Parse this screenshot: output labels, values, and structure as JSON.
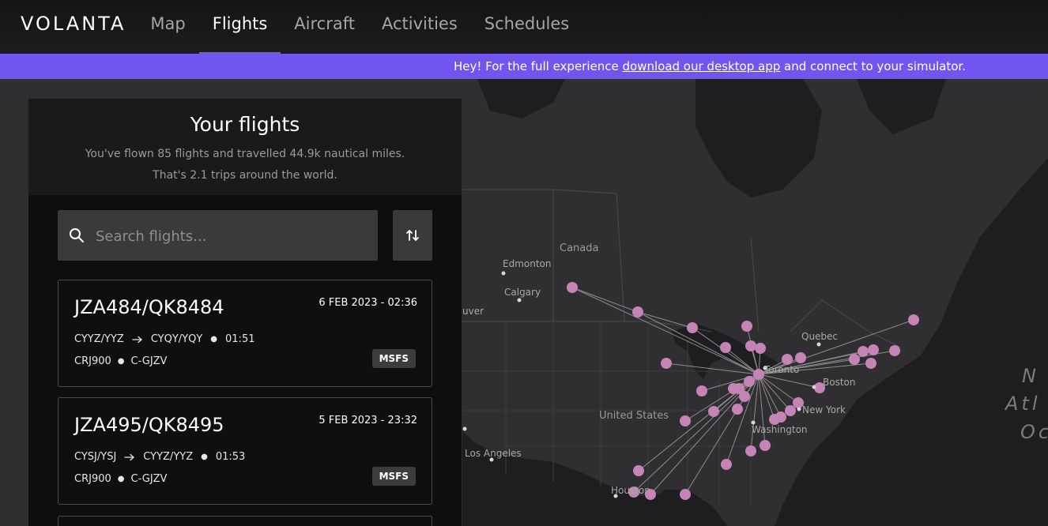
{
  "header": {
    "logo": "VOLANTA",
    "nav": [
      {
        "label": "Map"
      },
      {
        "label": "Flights"
      },
      {
        "label": "Aircraft"
      },
      {
        "label": "Activities"
      },
      {
        "label": "Schedules"
      }
    ],
    "active_nav": "Flights"
  },
  "banner": {
    "prefix": "Hey! For the full experience ",
    "link": "download our desktop app",
    "suffix": " and connect to your simulator."
  },
  "panel": {
    "title": "Your flights",
    "subtitle_line1": "You've flown 85 flights and travelled 44.9k nautical miles.",
    "subtitle_line2": "That's 2.1 trips around the world.",
    "search": {
      "placeholder": "Search flights..."
    },
    "flights": [
      {
        "callsign": "JZA484/QK8484",
        "date": "6 FEB 2023 - 02:36",
        "origin": "CYYZ/YYZ",
        "destination": "CYQY/YQY",
        "duration": "01:51",
        "aircraft_type": "CRJ900",
        "registration": "C-GJZV",
        "simulator": "MSFS"
      },
      {
        "callsign": "JZA495/QK8495",
        "date": "5 FEB 2023 - 23:32",
        "origin": "CYSJ/YSJ",
        "destination": "CYYZ/YYZ",
        "duration": "01:53",
        "aircraft_type": "CRJ900",
        "registration": "C-GJZV",
        "simulator": "MSFS"
      }
    ]
  },
  "map": {
    "labels": {
      "canada": "Canada",
      "edmonton": "Edmonton",
      "calgary": "Calgary",
      "vancouver": "uver",
      "quebec": "Quebec",
      "toronto": "Toronto",
      "boston": "Boston",
      "new_york": "New York",
      "washington": "Washington",
      "united_states": "United States",
      "los_angeles": "Los Angeles",
      "houston": "Houston",
      "ocean_line1": "N",
      "ocean_line2": "Atl",
      "ocean_line3": "Oc"
    },
    "hub": "Toronto",
    "route_color": "#8d8d8d",
    "airport_color": "#c583b6"
  },
  "colors": {
    "banner": "#7255f0",
    "panel": "#0e0e0e",
    "accent_underline": "#6f6aa0"
  }
}
